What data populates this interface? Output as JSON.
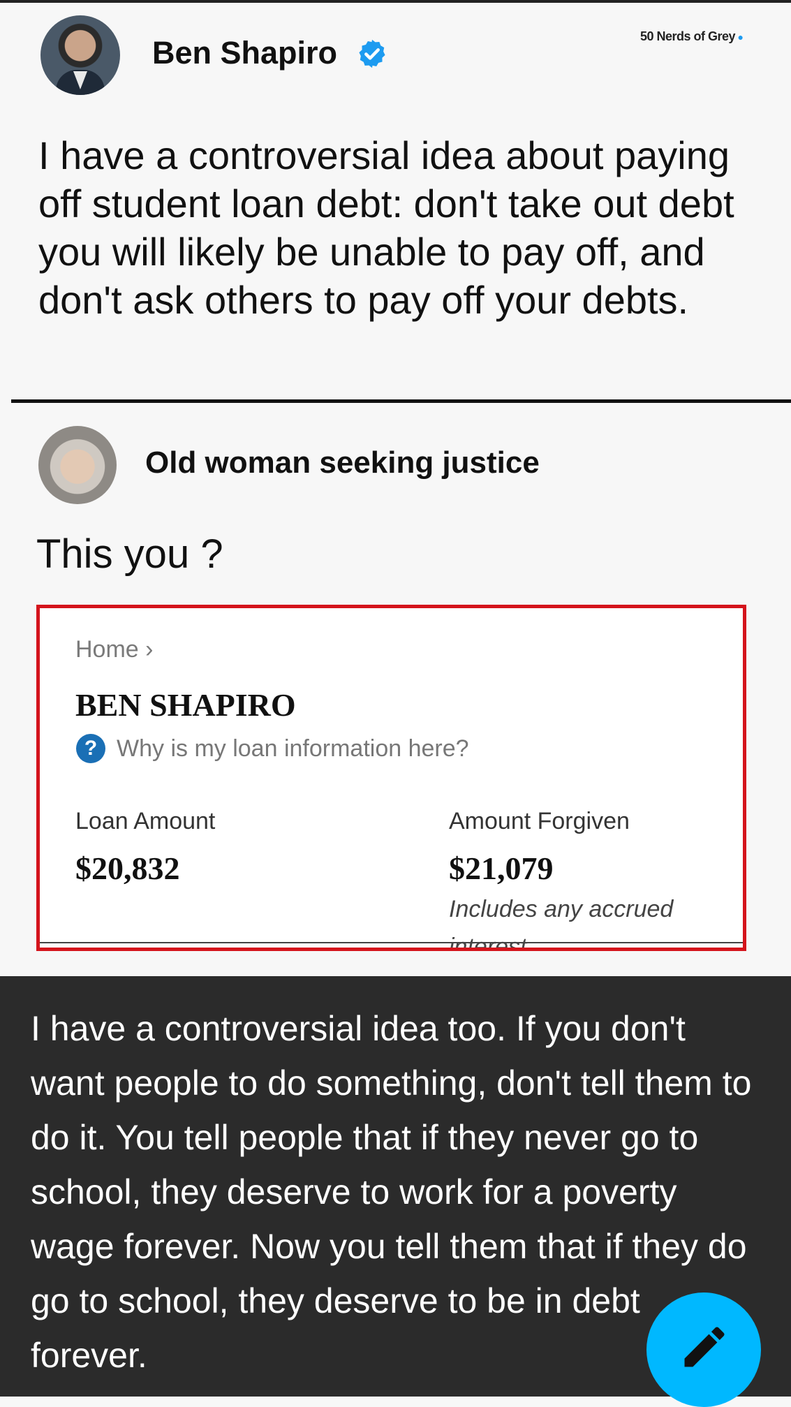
{
  "tweet": {
    "author": "Ben Shapiro",
    "watermark": "50 Nerds of Grey",
    "text": "I have a controversial idea about paying off student loan debt: don't take out debt you will likely be unable to pay off, and don't ask others to pay off your debts."
  },
  "reply": {
    "author": "Old woman seeking justice",
    "text": "This you ?"
  },
  "loan_card": {
    "breadcrumb": "Home ›",
    "name": "BEN SHAPIRO",
    "help_icon_glyph": "?",
    "help_link": "Why is my loan information here?",
    "loan_amount_label": "Loan Amount",
    "loan_amount_value": "$20,832",
    "forgiven_label": "Amount Forgiven",
    "forgiven_value": "$21,079",
    "forgiven_note": "Includes any accrued interest",
    "border_color": "#d4141c"
  },
  "post": {
    "text": "I have a controversial idea too. If you don't want people to do something, don't tell them to do it. You tell people that if they never go to school, they deserve to work for a poverty wage forever. Now you tell them that if they do go to school, they deserve to be in debt forever."
  },
  "fab": {
    "icon": "pencil-icon",
    "color": "#00b8ff"
  }
}
